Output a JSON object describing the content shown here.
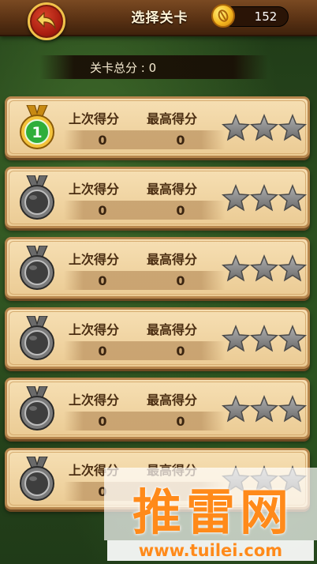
{
  "header": {
    "title": "选择关卡",
    "coins": "152",
    "back_icon": "back-arrow-icon",
    "coin_icon": "coin-icon"
  },
  "total_score_label": "关卡总分 : 0",
  "levels": [
    {
      "last_label": "上次得分",
      "best_label": "最高得分",
      "last_score": "0",
      "best_score": "0",
      "medal": "gold",
      "number": "1",
      "stars": 0
    },
    {
      "last_label": "上次得分",
      "best_label": "最高得分",
      "last_score": "0",
      "best_score": "0",
      "medal": "locked",
      "number": "",
      "stars": 0
    },
    {
      "last_label": "上次得分",
      "best_label": "最高得分",
      "last_score": "0",
      "best_score": "0",
      "medal": "locked",
      "number": "",
      "stars": 0
    },
    {
      "last_label": "上次得分",
      "best_label": "最高得分",
      "last_score": "0",
      "best_score": "0",
      "medal": "locked",
      "number": "",
      "stars": 0
    },
    {
      "last_label": "上次得分",
      "best_label": "最高得分",
      "last_score": "0",
      "best_score": "0",
      "medal": "locked",
      "number": "",
      "stars": 0
    },
    {
      "last_label": "上次得分",
      "best_label": "最高得分",
      "last_score": "0",
      "best_score": "",
      "medal": "locked",
      "number": "",
      "stars": 0
    }
  ],
  "watermark": {
    "main": "推雷网",
    "url": "www.tuilei.com"
  },
  "colors": {
    "gold_medal": "#e8b02a",
    "medal_number_bg": "#2fae3a",
    "locked_medal": "#5a5a5a",
    "star_empty": "#8d8d8d",
    "card_bg": "#f1d6a4",
    "watermark": "#ff8a1a"
  }
}
